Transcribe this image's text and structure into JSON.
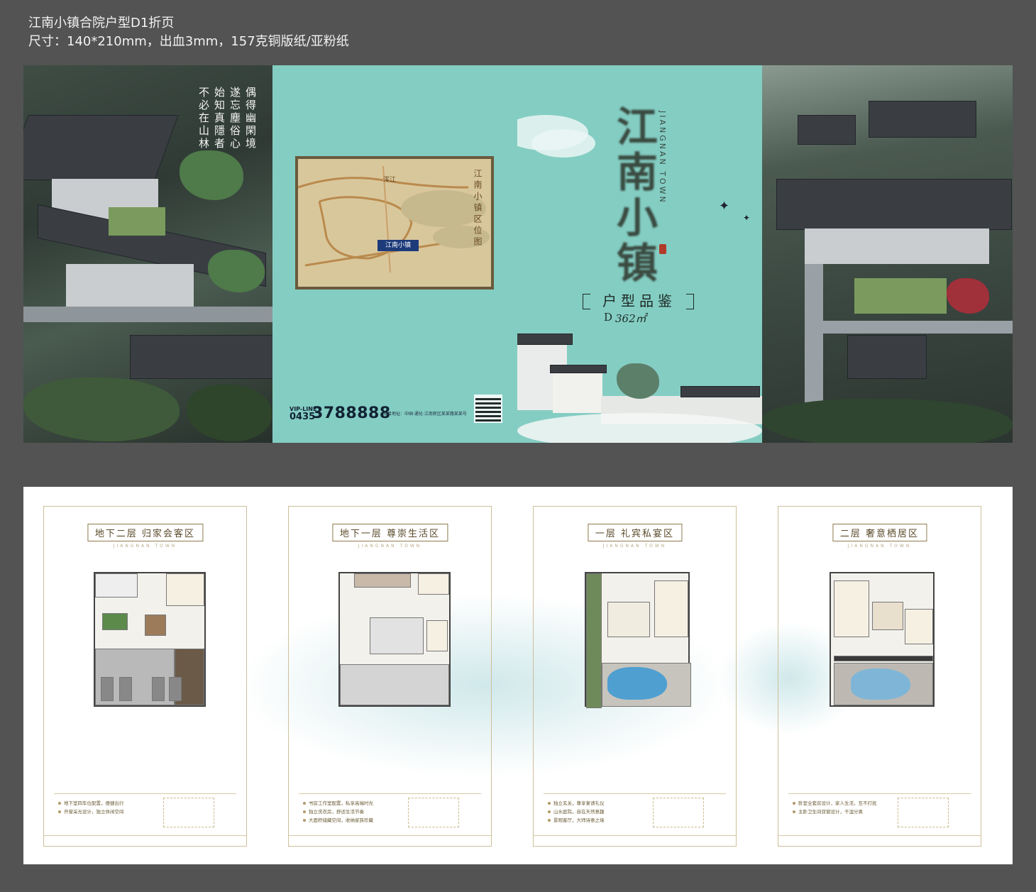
{
  "header": {
    "title": "江南小镇合院户型D1折页",
    "spec": "尺寸：140*210mm，出血3mm，157克铜版纸/亚粉纸"
  },
  "cover": {
    "poem": [
      "偶得幽閑境",
      "遂忘塵俗心",
      "始知真隱者",
      "不必在山林"
    ],
    "map_title": "江南小镇区位图",
    "map_town": "江南小镇",
    "map_labels": [
      "浑江",
      "江南小镇"
    ],
    "vip_label": "VIP-LINE",
    "area_code": "0435",
    "phone": "3788888",
    "address": "项目地址：中国·通化·江南新区某某路某某号",
    "title": "江南小镇",
    "title_en": "JIANGNAN TOWN",
    "product_title": "户型品鉴",
    "unit_type": "D",
    "unit_area": "362㎡"
  },
  "floorplans": [
    {
      "title": "地下二层 归家会客区",
      "en": "JIANGNAN TOWN",
      "bullets": [
        "地下室四车位配置，便捷出行",
        "开窗采光设计，独立休闲空间"
      ]
    },
    {
      "title": "地下一层 尊崇生活区",
      "en": "JIANGNAN TOWN",
      "bullets": [
        "书房工作室配置，私享高端时光",
        "独立洗衣房，舒适生活节奏",
        "大面积储藏空间，收纳家族珍藏"
      ]
    },
    {
      "title": "一层 礼宾私宴区",
      "en": "JIANGNAN TOWN",
      "bullets": [
        "独立玄关，尊享宴请礼仪",
        "山水庭院，自在天然意趣",
        "景观客厅，大师诗意之境"
      ]
    },
    {
      "title": "二层 奢意栖居区",
      "en": "JIANGNAN TOWN",
      "bullets": [
        "卧室全套房设计，家人生活，互不打扰",
        "主卧卫生间双窗设计，干湿分离"
      ]
    }
  ]
}
